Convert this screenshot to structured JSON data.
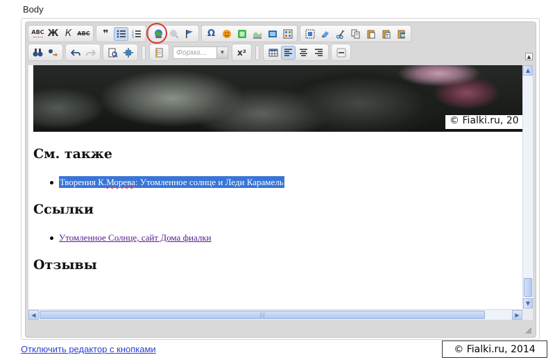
{
  "field_label": "Body",
  "toolbar_row1": {
    "spell": "ABC",
    "bold": "Ж",
    "italic": "К",
    "strike": "ABC",
    "quote": "❞",
    "omega": "Ω"
  },
  "toolbar_row2": {
    "format_placeholder": "Форма...",
    "superscript": "x²"
  },
  "content": {
    "photo_watermark": "© Fialki.ru, 20",
    "headings": [
      "См. также",
      "Ссылки",
      "Отзывы"
    ],
    "see_also_link_part1": "Творения К.",
    "see_also_link_part2": "Морева",
    "see_also_link_part3": ": Утомленное солнце и Леди Карамель",
    "links_item": "Утомленное Солнце, сайт Дома фиалки"
  },
  "disable_editor_link": "Отключить редактор с кнопками",
  "page_watermark": "© Fialki.ru, 2014",
  "colors": {
    "selection": "#3875d7",
    "visited_link": "#551a8b",
    "highlight_ring": "#e03131",
    "plain_link": "#2a3fd6"
  }
}
